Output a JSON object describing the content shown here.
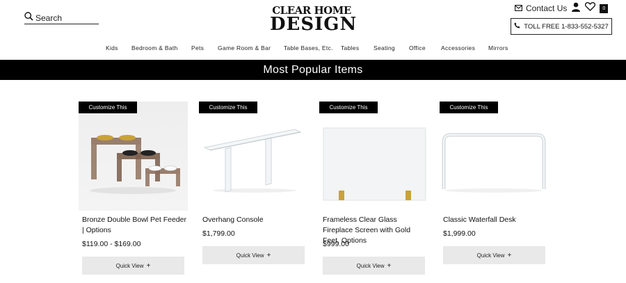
{
  "header": {
    "search_label": "Search",
    "logo_top": "CLEAR HOME",
    "logo_bottom": "DESIGN",
    "contact_label": "Contact Us",
    "cart_count": "0",
    "toll_free": "TOLL FREE 1-833-552-5327"
  },
  "nav": [
    "Kids",
    "Bedroom & Bath",
    "Pets",
    "Game Room & Bar",
    "Table Bases, Etc.",
    "Tables",
    "Seating",
    "Office",
    "Accessories",
    "Mirrors"
  ],
  "banner": {
    "title": "Most Popular Items"
  },
  "products": [
    {
      "badge": "Customize This",
      "name": "Bronze Double Bowl Pet Feeder | Options",
      "price": "$119.00 - $169.00",
      "quick_view": "Quick View"
    },
    {
      "badge": "Customize This",
      "name": "Overhang Console",
      "price": "$1,799.00",
      "quick_view": "Quick View"
    },
    {
      "badge": "Customize This",
      "name": "Frameless Clear Glass Fireplace Screen with Gold Feet, Options",
      "price": "$999.00",
      "quick_view": "Quick View"
    },
    {
      "badge": "Customize This",
      "name": "Classic Waterfall Desk",
      "price": "$1,999.00",
      "quick_view": "Quick View"
    }
  ],
  "icons": {
    "search": "search-icon",
    "mail": "mail-icon",
    "user": "user-icon",
    "heart": "heart-icon",
    "cart": "cart-icon",
    "phone": "phone-icon",
    "plus": "plus-icon"
  }
}
